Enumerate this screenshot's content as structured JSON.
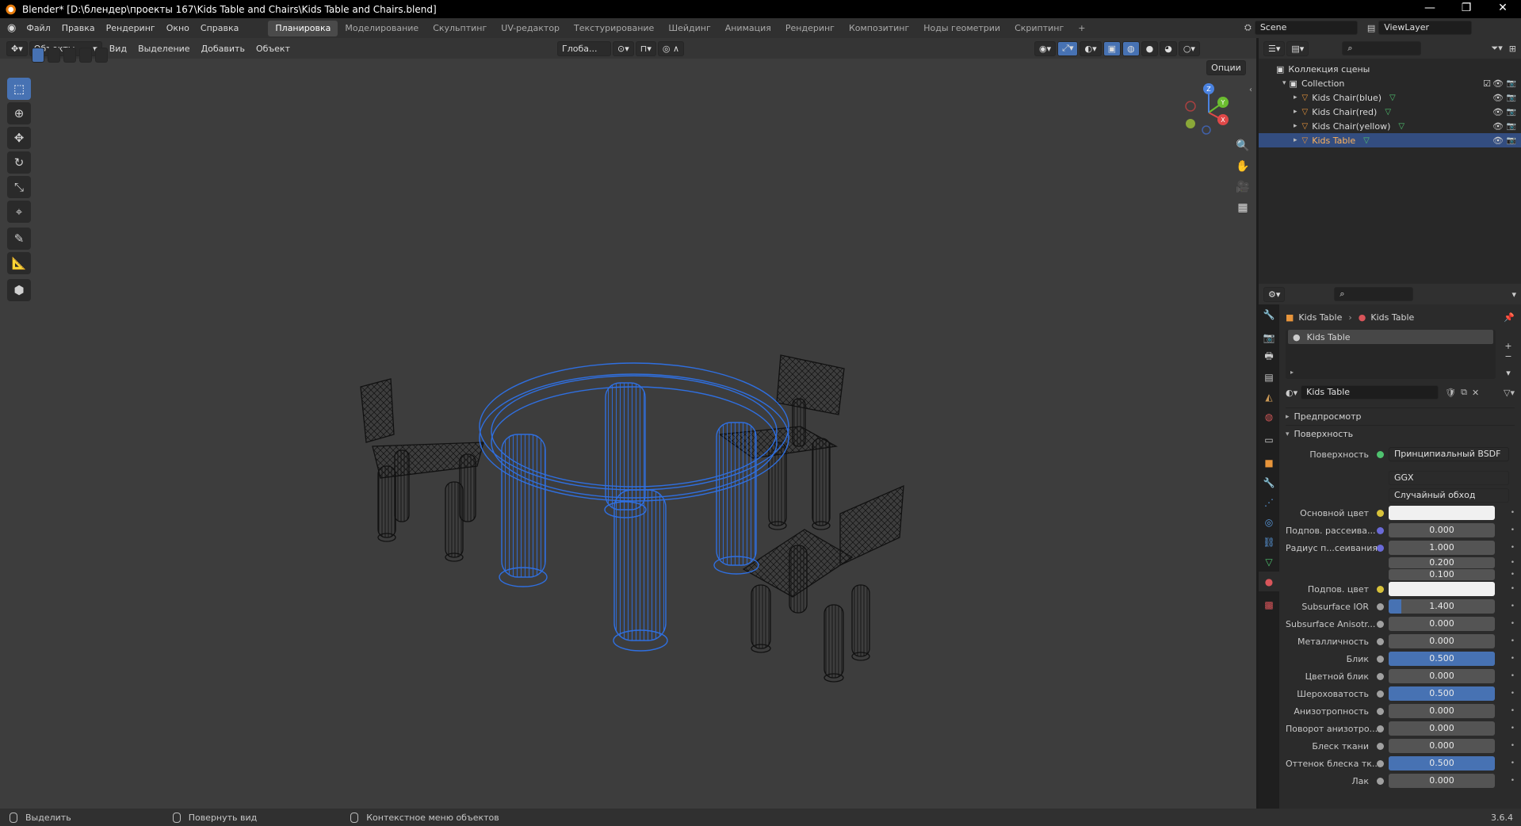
{
  "window": {
    "title": "Blender* [D:\\блендер\\проекты 167\\Kids Table and Chairs\\Kids Table and Chairs.blend]",
    "minimize": "—",
    "maximize": "❐",
    "close": "✕"
  },
  "menu": [
    "Файл",
    "Правка",
    "Рендеринг",
    "Окно",
    "Справка"
  ],
  "workspaces": [
    "Планировка",
    "Моделирование",
    "Скульптинг",
    "UV-редактор",
    "Текстурирование",
    "Шейдинг",
    "Анимация",
    "Рендеринг",
    "Композитинг",
    "Ноды геометрии",
    "Скриптинг",
    "+"
  ],
  "active_workspace": "Планировка",
  "scene": {
    "name": "Scene",
    "view_layer": "ViewLayer"
  },
  "viewport": {
    "mode": "Объекты",
    "menus": [
      "Вид",
      "Выделение",
      "Добавить",
      "Объект"
    ],
    "transform_orientation": "Глоба...",
    "options_label": "Опции",
    "axes": {
      "x": "X",
      "y": "Y",
      "z": "Z"
    }
  },
  "outliner": {
    "scene_collection": "Коллекция сцены",
    "collection": "Collection",
    "objects": [
      {
        "name": "Kids Chair(blue)",
        "selected": false
      },
      {
        "name": "Kids Chair(red)",
        "selected": false
      },
      {
        "name": "Kids Chair(yellow)",
        "selected": false
      },
      {
        "name": "Kids Table",
        "selected": true
      }
    ]
  },
  "properties": {
    "breadcrumb_object": "Kids Table",
    "breadcrumb_material": "Kids Table",
    "material_slot": "Kids Table",
    "material_name": "Kids Table",
    "sections": {
      "preview": "Предпросмотр",
      "surface": "Поверхность"
    },
    "surface_label": "Поверхность",
    "surface_shader": "Принципиальный BSDF",
    "distribution": "GGX",
    "subsurface_method": "Случайный обход",
    "rows": [
      {
        "label": "Основной цвет",
        "type": "color",
        "color": "#f0f0f0",
        "dot": "#d8c23a"
      },
      {
        "label": "Подпов. рассеива...",
        "type": "num",
        "value": "0.000",
        "fill": 0,
        "dot": "#6a6ad8"
      },
      {
        "label": "Радиус п...сеивания",
        "type": "num",
        "value": "1.000",
        "fill": 0,
        "dot": "#6a6ad8"
      },
      {
        "label": "",
        "type": "num",
        "value": "0.200",
        "fill": 0,
        "dot": ""
      },
      {
        "label": "",
        "type": "num",
        "value": "0.100",
        "fill": 0,
        "dot": ""
      },
      {
        "label": "Подпов. цвет",
        "type": "color",
        "color": "#f0f0f0",
        "dot": "#d8c23a"
      },
      {
        "label": "Subsurface IOR",
        "type": "num",
        "value": "1.400",
        "fill": 0.12,
        "dot": "#a0a0a0"
      },
      {
        "label": "Subsurface Anisotr...",
        "type": "num",
        "value": "0.000",
        "fill": 0,
        "dot": "#a0a0a0"
      },
      {
        "label": "Металличность",
        "type": "num",
        "value": "0.000",
        "fill": 0,
        "dot": "#a0a0a0"
      },
      {
        "label": "Блик",
        "type": "num",
        "value": "0.500",
        "fill": 1,
        "dot": "#a0a0a0"
      },
      {
        "label": "Цветной блик",
        "type": "num",
        "value": "0.000",
        "fill": 0,
        "dot": "#a0a0a0"
      },
      {
        "label": "Шероховатость",
        "type": "num",
        "value": "0.500",
        "fill": 1,
        "dot": "#a0a0a0"
      },
      {
        "label": "Анизотропность",
        "type": "num",
        "value": "0.000",
        "fill": 0,
        "dot": "#a0a0a0"
      },
      {
        "label": "Поворот анизотро...",
        "type": "num",
        "value": "0.000",
        "fill": 0,
        "dot": "#a0a0a0"
      },
      {
        "label": "Блеск ткани",
        "type": "num",
        "value": "0.000",
        "fill": 0,
        "dot": "#a0a0a0"
      },
      {
        "label": "Оттенок блеска тк...",
        "type": "num",
        "value": "0.500",
        "fill": 1,
        "dot": "#a0a0a0"
      },
      {
        "label": "Лак",
        "type": "num",
        "value": "0.000",
        "fill": 0,
        "dot": "#a0a0a0"
      }
    ]
  },
  "status": {
    "select": "Выделить",
    "rotate_view": "Повернуть вид",
    "context_menu": "Контекстное меню объектов",
    "version": "3.6.4"
  },
  "colors": {
    "accent": "#4772b3",
    "selected_wire": "#2f6fe0",
    "wire": "#111111",
    "viewport_bg": "#3d3d3d"
  }
}
